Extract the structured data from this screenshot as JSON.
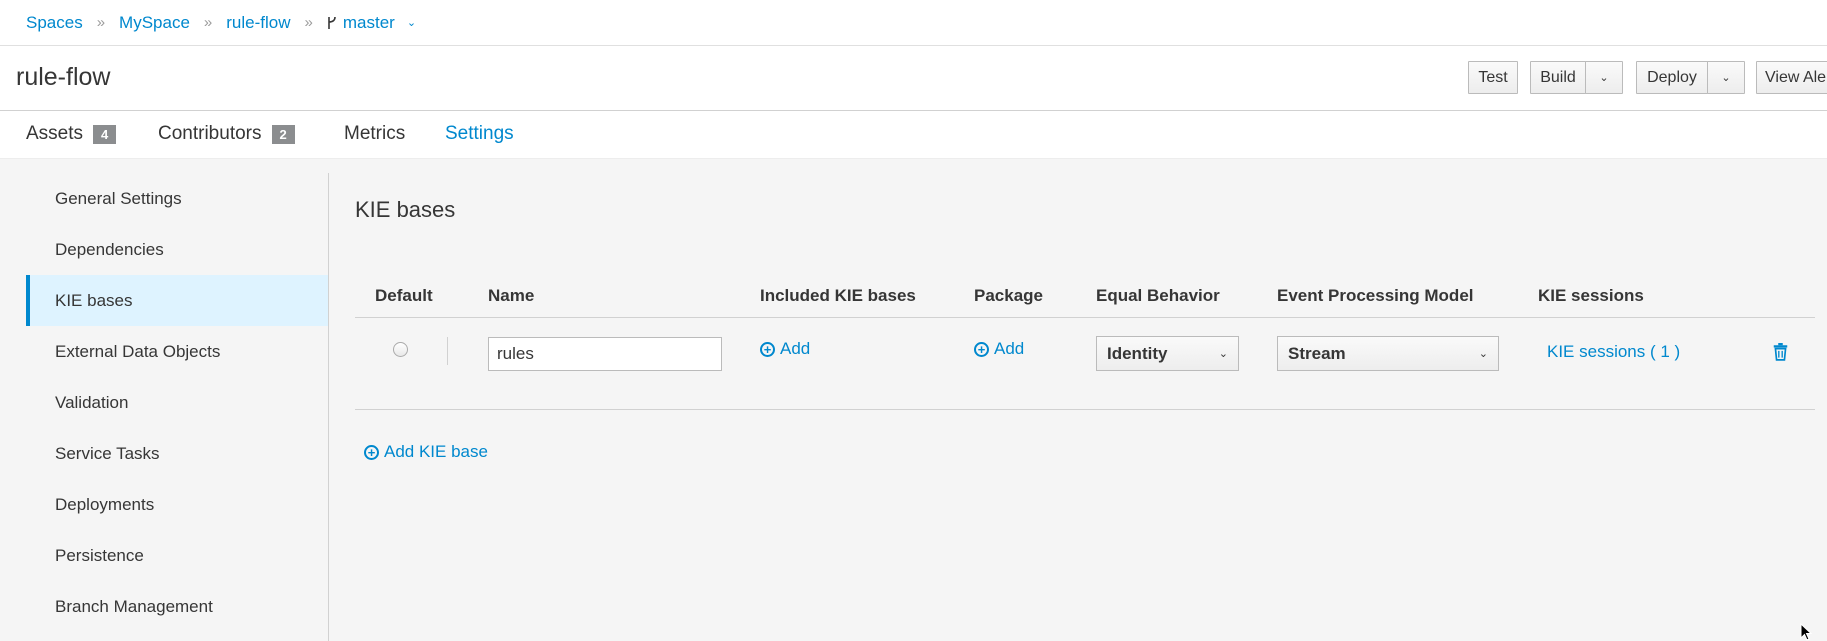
{
  "breadcrumb": {
    "items": [
      "Spaces",
      "MySpace",
      "rule-flow"
    ],
    "branch": "master"
  },
  "header": {
    "title": "rule-flow",
    "buttons": {
      "test": "Test",
      "build": "Build",
      "deploy": "Deploy",
      "view_alerts": "View Ale"
    }
  },
  "tabs": [
    {
      "label": "Assets",
      "badge": "4"
    },
    {
      "label": "Contributors",
      "badge": "2"
    },
    {
      "label": "Metrics"
    },
    {
      "label": "Settings",
      "active": true
    }
  ],
  "sidebar": {
    "items": [
      {
        "label": "General Settings"
      },
      {
        "label": "Dependencies"
      },
      {
        "label": "KIE bases",
        "active": true
      },
      {
        "label": "External Data Objects"
      },
      {
        "label": "Validation"
      },
      {
        "label": "Service Tasks"
      },
      {
        "label": "Deployments"
      },
      {
        "label": "Persistence"
      },
      {
        "label": "Branch Management"
      }
    ]
  },
  "kie_bases": {
    "title": "KIE bases",
    "columns": [
      "Default",
      "Name",
      "Included KIE bases",
      "Package",
      "Equal Behavior",
      "Event Processing Model",
      "KIE sessions"
    ],
    "rows": [
      {
        "name": "rules",
        "included_add": "Add",
        "package_add": "Add",
        "equal_behavior": "Identity",
        "event_processing": "Stream",
        "sessions": "KIE sessions ( 1 )"
      }
    ],
    "add_button": "Add KIE base"
  },
  "colors": {
    "accent": "#0088ce",
    "active_nav_bg": "#def3ff",
    "content_bg": "#f5f5f5"
  }
}
